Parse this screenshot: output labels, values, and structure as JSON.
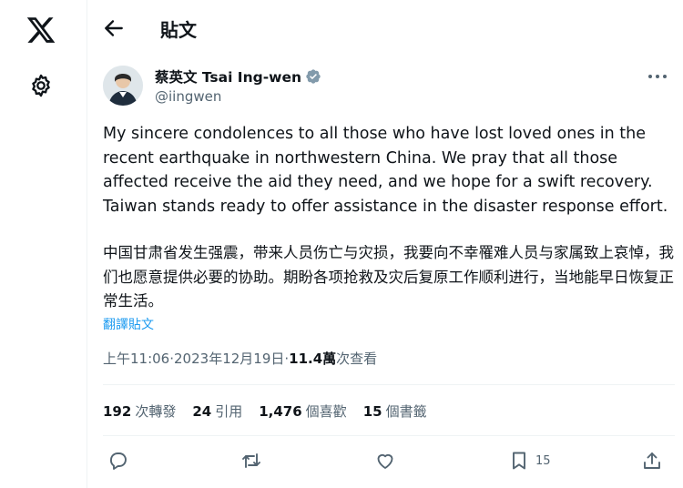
{
  "header": {
    "title": "貼文"
  },
  "author": {
    "display_name": "蔡英文 Tsai Ing-wen",
    "handle": "@iingwen",
    "verified": true
  },
  "tweet": {
    "text_en": "My sincere condolences to all those who have lost loved ones in the recent earthquake in northwestern China. We pray that all those affected receive the aid they need, and we hope for a swift recovery. Taiwan stands ready to offer assistance in the disaster response effort.",
    "text_cn": "中国甘肃省发生强震，带来人员伤亡与灾损，我要向不幸罹难人员与家属致上哀悼，我们也愿意提供必要的协助。期盼各项抢救及灾后复原工作顺利进行，当地能早日恢复正常生活。",
    "translate_label": "翻譯貼文"
  },
  "meta": {
    "time": "上午11:06",
    "sep1": " · ",
    "date": "2023年12月19日",
    "sep2": " · ",
    "views_count": "11.4萬",
    "views_label": " 次查看"
  },
  "stats": [
    {
      "num": "192",
      "label": "次轉發"
    },
    {
      "num": "24",
      "label": "引用"
    },
    {
      "num": "1,476",
      "label": "個喜歡"
    },
    {
      "num": "15",
      "label": "個書籤"
    }
  ],
  "actions": {
    "bookmark_count": "15"
  },
  "icons": {
    "rail_logo": "x-logo-icon",
    "rail_settings": "gear-icon",
    "back": "arrow-left-icon",
    "more": "more-horizontal-icon",
    "verified": "verified-badge-icon",
    "reply": "reply-icon",
    "retweet": "retweet-icon",
    "like": "heart-icon",
    "bookmark": "bookmark-icon",
    "share": "share-icon"
  },
  "colors": {
    "accent": "#1d9bf0",
    "text": "#0f1419",
    "muted": "#536471",
    "verified_badge": "#829aab"
  }
}
